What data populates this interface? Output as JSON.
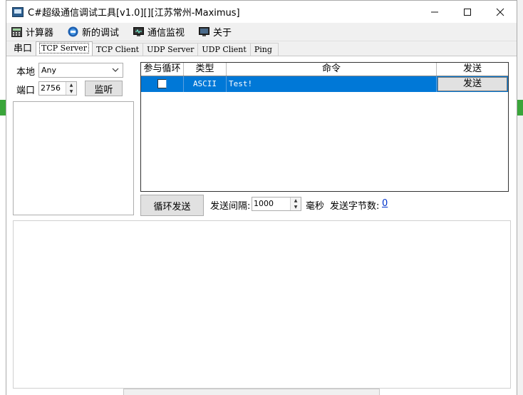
{
  "window": {
    "title": "C#超级通信调试工具[v1.0][][江苏常州-Maximus]",
    "minimize": "—",
    "maximize": "☐",
    "close": "✕"
  },
  "menu": [
    {
      "label": "计算器",
      "icon": "calculator-icon"
    },
    {
      "label": "新的调试",
      "icon": "new-debug-icon"
    },
    {
      "label": "通信监视",
      "icon": "monitor-icon"
    },
    {
      "label": "关于",
      "icon": "about-icon"
    }
  ],
  "tabs": [
    "串口",
    "TCP Server",
    "TCP Client",
    "UDP Server",
    "UDP Client",
    "Ping"
  ],
  "active_tab": "TCP Server",
  "server": {
    "local_label": "本地",
    "local_value": "Any",
    "port_label": "端口",
    "port_value": "2756",
    "listen_label": "监听"
  },
  "grid": {
    "headers": [
      "参与循环",
      "类型",
      "命令",
      "发送"
    ],
    "rows": [
      {
        "loop": false,
        "type": "ASCII",
        "command": "Test!",
        "send_label": "发送"
      }
    ]
  },
  "loop": {
    "button_label": "循环发送",
    "interval_label": "发送间隔:",
    "interval_value": "1000",
    "unit_label": "毫秒",
    "bytes_label": "发送字节数:",
    "bytes_value": "0"
  },
  "colors": {
    "selection": "#0078d7",
    "link": "#0033cc",
    "bg_green": "#3aa53a"
  }
}
